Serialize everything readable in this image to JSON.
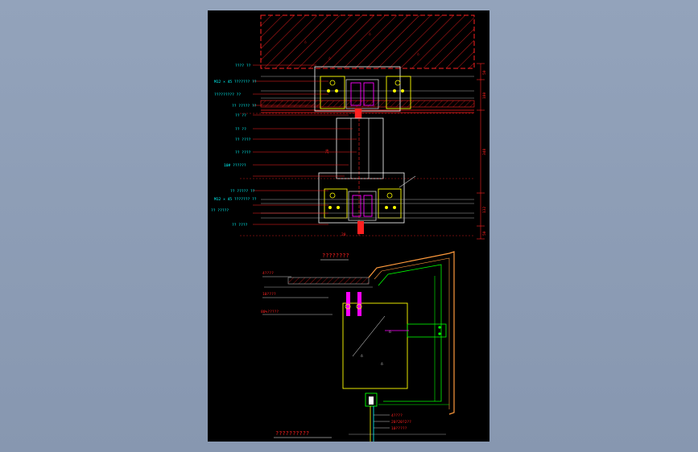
{
  "colors": {
    "background": "#8b9bb3",
    "sheet": "#000000",
    "red": "#ff2020",
    "cyan": "#00ffff",
    "yellow": "#ffff00",
    "white": "#ffffff",
    "magenta": "#ff00ff",
    "green": "#00ff00",
    "orange": "#ff9a3c",
    "gray": "#9a9a9a"
  },
  "top_labels": [
    "???? ??",
    "M12 × 45 ??????? ??",
    "????????? ??",
    "?? ????? ??",
    "?? ??",
    "?? ??",
    "?? ????",
    "?? ????",
    "10# ??????",
    "?? ????? ??",
    "M12 × 45 ??????? ??",
    "?? ?????",
    "?? ????"
  ],
  "top_marks": [
    "20",
    "20"
  ],
  "dimensions": [
    "50",
    "180",
    "348",
    "132",
    "50"
  ],
  "bottom_labels": [
    "4????",
    "10????",
    "80%?????"
  ],
  "right_labels": [
    "4????",
    "20?20?2??",
    "10?????"
  ],
  "section_title": "????????",
  "bottom_title": "??????????"
}
